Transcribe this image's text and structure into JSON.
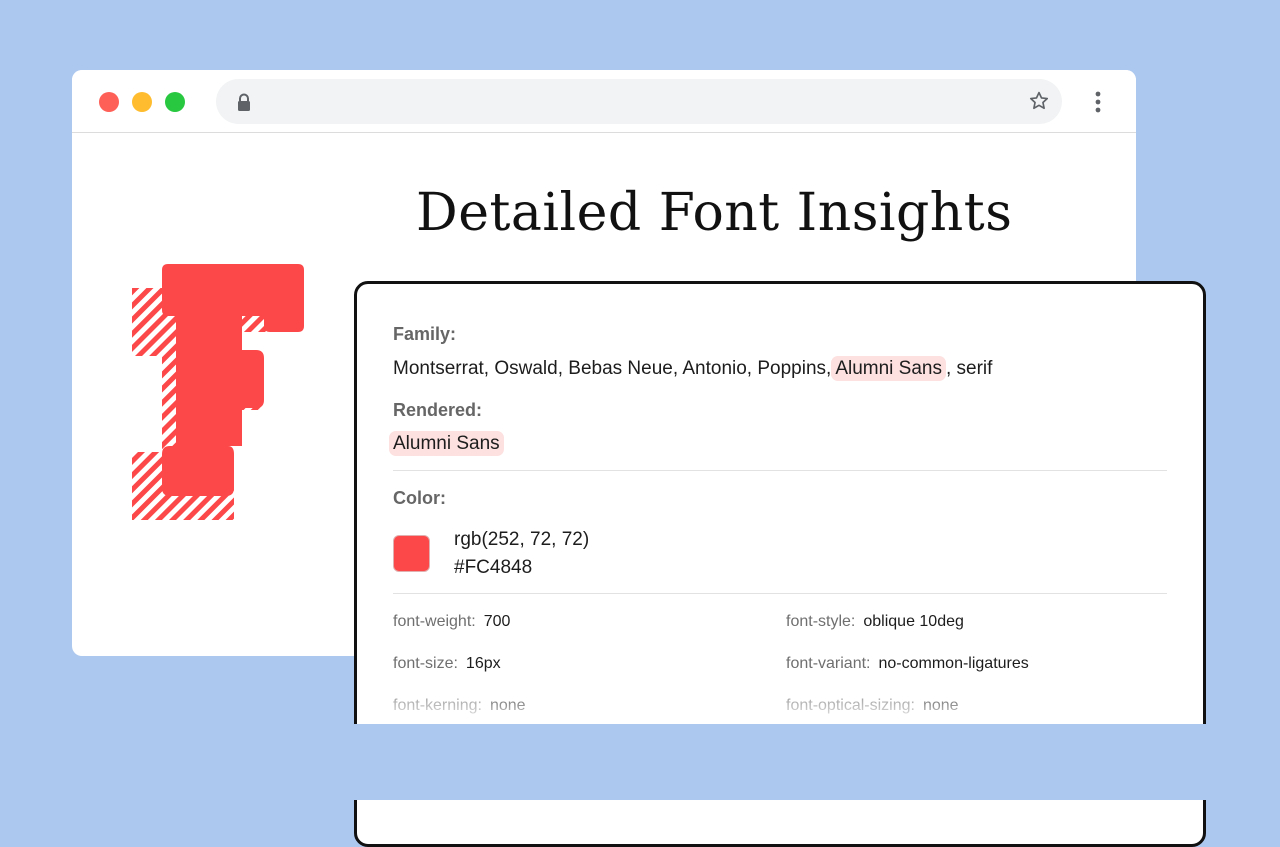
{
  "colors": {
    "background": "#adc8ee",
    "traffic_red": "#fe5f57",
    "traffic_yellow": "#febc2e",
    "traffic_green": "#28c840",
    "accent": "#fc4848",
    "highlight": "#fde0e0"
  },
  "browser": {
    "toolbar": {
      "icons": [
        "lock-icon",
        "star-icon",
        "kebab-menu-icon"
      ]
    }
  },
  "headline": "Detailed Font Insights",
  "panel": {
    "family_label": "Family:",
    "family_list": "Montserrat, Oswald, Bebas Neue, Antonio, Poppins,",
    "family_match": "Alumni Sans",
    "family_tail": ", serif",
    "rendered_label": "Rendered:",
    "rendered_value": "Alumni Sans",
    "color_label": "Color:",
    "color_rgb": "rgb(252, 72, 72)",
    "color_hex": "#FC4848",
    "properties": [
      {
        "key": "font-weight:",
        "value": "700"
      },
      {
        "key": "font-style:",
        "value": "oblique 10deg"
      },
      {
        "key": "font-size:",
        "value": "16px"
      },
      {
        "key": "font-variant:",
        "value": "no-common-ligatures"
      },
      {
        "key": "font-kerning:",
        "value": "none"
      },
      {
        "key": "font-optical-sizing:",
        "value": "none"
      }
    ]
  }
}
